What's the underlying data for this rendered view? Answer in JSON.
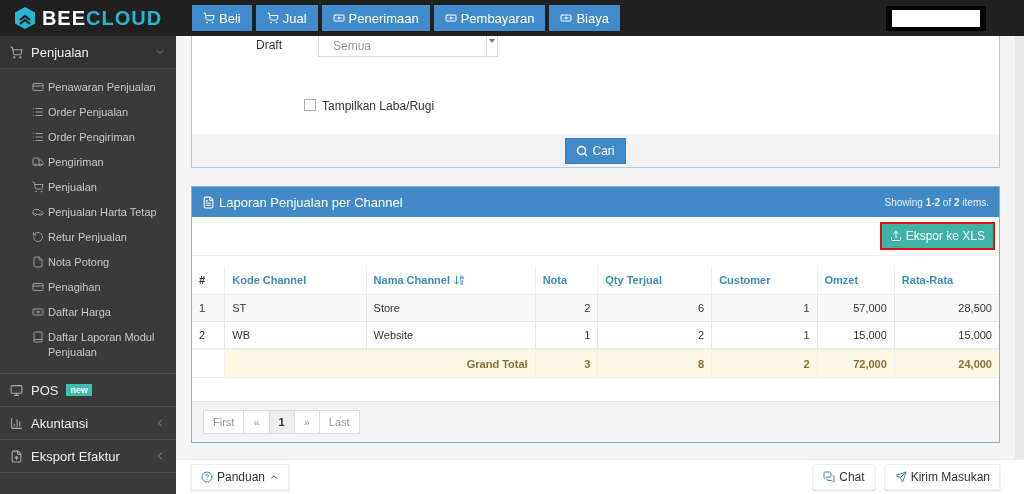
{
  "logo": {
    "text_1": "BEE",
    "text_2": "CLOUD"
  },
  "nav_buttons": [
    "Beli",
    "Jual",
    "Penerimaan",
    "Pembayaran",
    "Biaya"
  ],
  "sidebar": [
    {
      "kind": "group",
      "label": "Penjualan",
      "expanded": true,
      "children": [
        {
          "label": "Penawaran Penjualan"
        },
        {
          "label": "Order Penjualan"
        },
        {
          "label": "Order Pengiriman"
        },
        {
          "label": "Pengiriman"
        },
        {
          "label": "Penjualan"
        },
        {
          "label": "Penjualan Harta Tetap"
        },
        {
          "label": "Retur Penjualan"
        },
        {
          "label": "Nota Potong"
        },
        {
          "label": "Penagihan"
        },
        {
          "label": "Daftar Harga"
        },
        {
          "label": "Daftar Laporan Modul Penjualan"
        }
      ]
    },
    {
      "kind": "link",
      "label": "POS",
      "badge": "new"
    },
    {
      "kind": "group",
      "label": "Akuntansi",
      "expanded": false
    },
    {
      "kind": "group",
      "label": "Eksport Efaktur",
      "expanded": false
    }
  ],
  "filter": {
    "draft_label": "Draft",
    "draft_value": "Semua",
    "checkbox": {
      "label": "Tampilkan Laba/Rugi",
      "checked": false
    },
    "search_button": "Cari"
  },
  "report": {
    "title": "Laporan Penjualan per Channel",
    "summary": "Showing **1-2** of **2** items.",
    "export_button": "Ekspor ke XLS",
    "columns": [
      {
        "label": "#",
        "sorted": false
      },
      {
        "label": "Kode Channel",
        "sorted": false
      },
      {
        "label": "Nama Channel",
        "sorted": true
      },
      {
        "label": "Nota",
        "sorted": false
      },
      {
        "label": "Qty Terjual",
        "sorted": false
      },
      {
        "label": "Customer",
        "sorted": false
      },
      {
        "label": "Omzet",
        "sorted": false
      },
      {
        "label": "Rata-Rata",
        "sorted": false
      }
    ],
    "rows": [
      [
        "1",
        "ST",
        "Store",
        "2",
        "6",
        "1",
        "57,000",
        "28,500"
      ],
      [
        "2",
        "WB",
        "Website",
        "1",
        "2",
        "1",
        "15,000",
        "15,000"
      ]
    ],
    "total": {
      "label": "Grand Total",
      "values": [
        "3",
        "8",
        "2",
        "72,000",
        "24,000"
      ]
    },
    "pagination": [
      {
        "label": "First",
        "selected": false,
        "disabled": true
      },
      {
        "label": "«",
        "selected": false,
        "disabled": true
      },
      {
        "label": "1",
        "selected": true,
        "disabled": false
      },
      {
        "label": "»",
        "selected": false,
        "disabled": true
      },
      {
        "label": "Last",
        "selected": false,
        "disabled": true
      }
    ]
  },
  "footer": {
    "help_button": "Panduan",
    "chat_button": "Chat",
    "feedback_button": "Kirim Masukan"
  }
}
